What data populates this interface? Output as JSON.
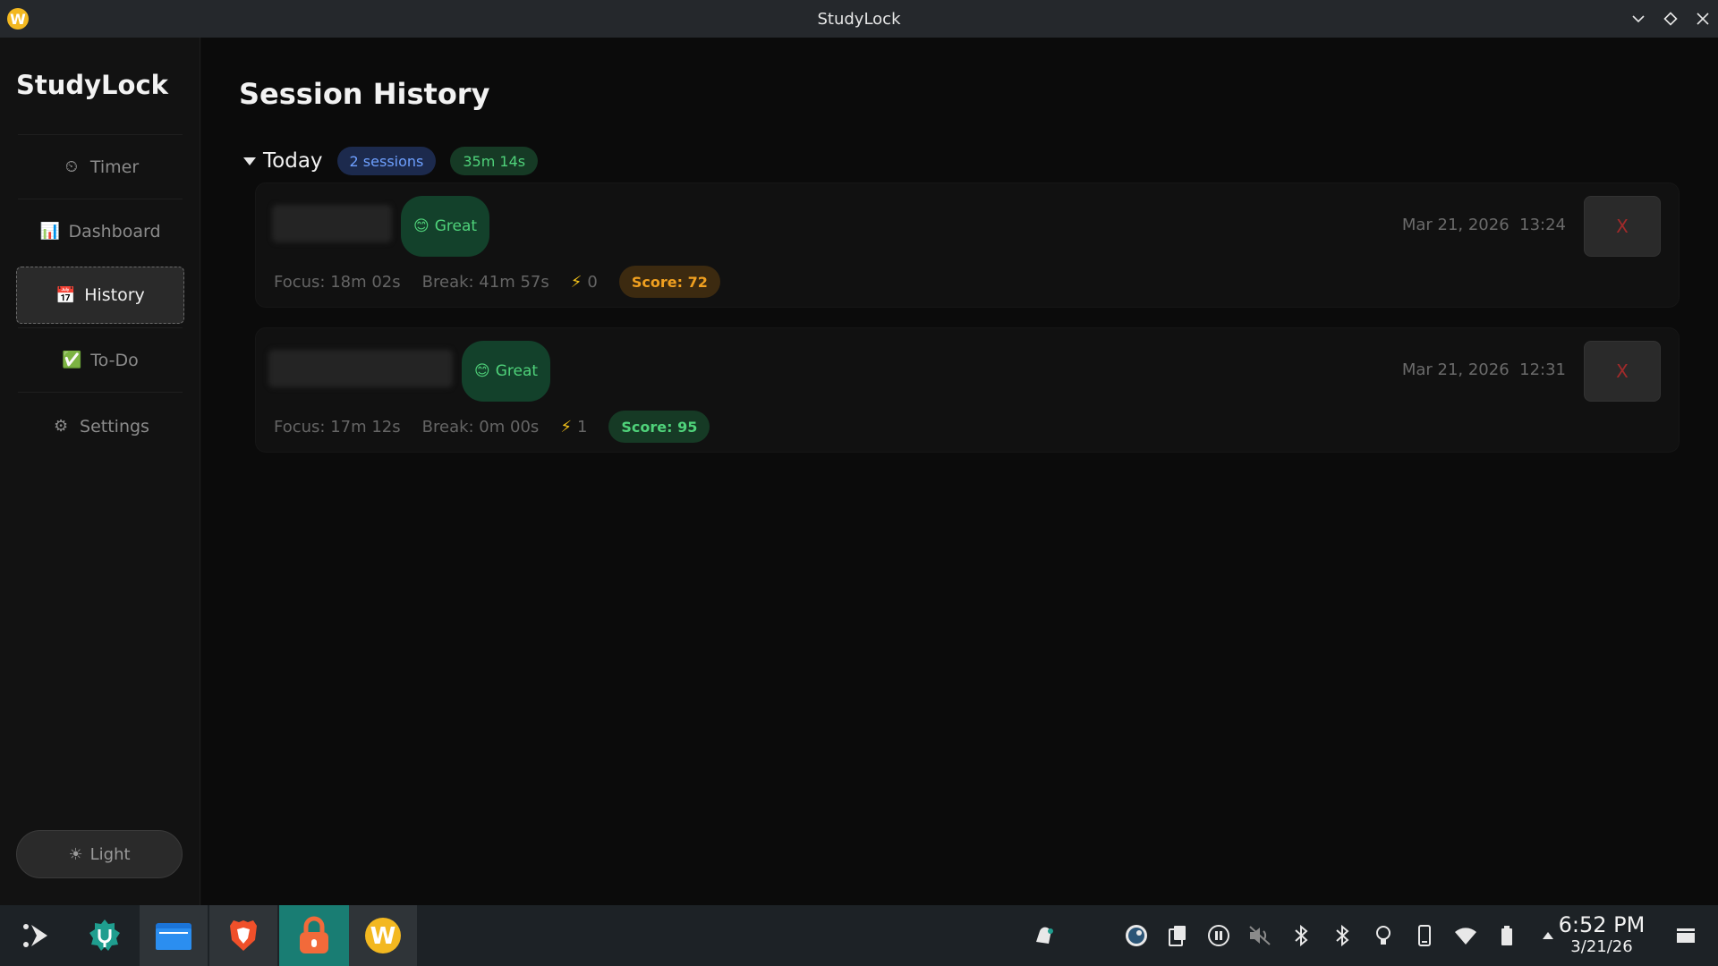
{
  "window": {
    "title": "StudyLock",
    "app_icon_letter": "W"
  },
  "sidebar": {
    "brand": "StudyLock",
    "items": [
      {
        "icon": "timer-icon",
        "glyph": "⏲",
        "label": "Timer"
      },
      {
        "icon": "bar-chart-icon",
        "glyph": "📊",
        "label": "Dashboard"
      },
      {
        "icon": "calendar-icon",
        "glyph": "📅",
        "label": "History"
      },
      {
        "icon": "check-icon",
        "glyph": "✅",
        "label": "To-Do"
      },
      {
        "icon": "gear-icon",
        "glyph": "⚙",
        "label": "Settings"
      }
    ],
    "active_item": "History",
    "theme_toggle": {
      "glyph": "☀",
      "label": "Light"
    }
  },
  "main": {
    "title": "Session History",
    "group": {
      "label": "Today",
      "sessions_badge": "2 sessions",
      "duration_badge": "35m 14s"
    },
    "sessions": [
      {
        "mood_glyph": "😊",
        "mood": "Great",
        "date": "Mar 21, 2026",
        "time": "13:24",
        "delete_label": "X",
        "focus": "Focus: 18m 02s",
        "break": "Break: 41m 57s",
        "interruptions_glyph": "⚡",
        "interruptions": "0",
        "score": "Score: 72",
        "score_color": "#f0a020"
      },
      {
        "mood_glyph": "😊",
        "mood": "Great",
        "date": "Mar 21, 2026",
        "time": "12:31",
        "delete_label": "X",
        "focus": "Focus: 17m 12s",
        "break": "Break: 0m 00s",
        "interruptions_glyph": "⚡",
        "interruptions": "1",
        "score": "Score: 95",
        "score_color": "#4fd27a"
      }
    ]
  },
  "taskbar": {
    "apps": [
      "launcher-icon",
      "discover-icon",
      "files-icon",
      "brave-browser-icon",
      "studylock-icon",
      "w-app-icon"
    ],
    "tray": [
      "notifications-icon",
      "steam-icon",
      "clipboard-icon",
      "media-pause-icon",
      "volume-muted-icon",
      "bluetooth-icon",
      "bluetooth-icon",
      "night-light-icon",
      "phone-icon",
      "wifi-icon",
      "battery-icon",
      "tray-expand-icon"
    ],
    "clock_time": "6:52 PM",
    "clock_date": "3/21/26"
  },
  "colors": {
    "accent_green": "#4fd27a",
    "accent_blue": "#6ea0ff",
    "score_orange": "#f0a020",
    "taskbar_active": "#197d73"
  }
}
